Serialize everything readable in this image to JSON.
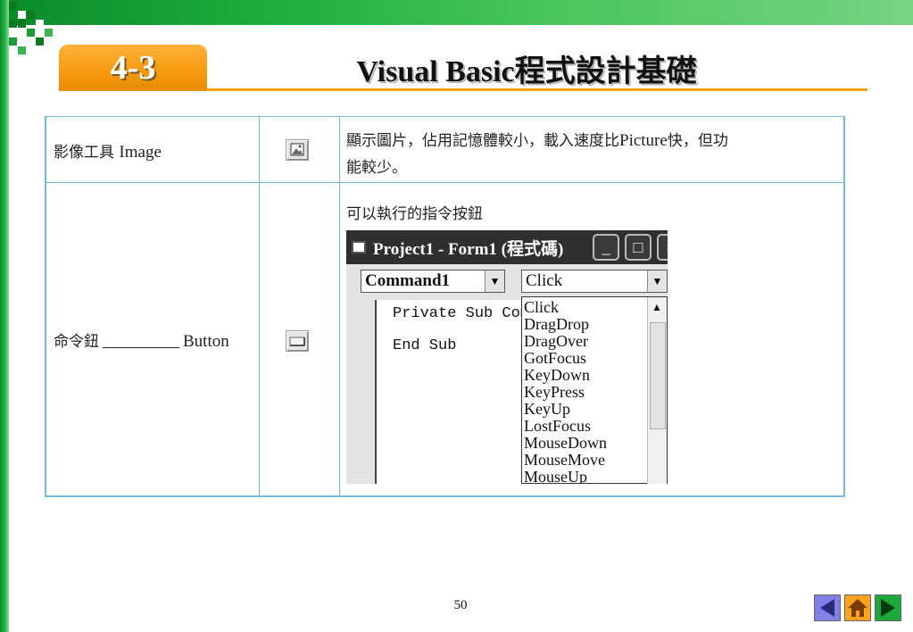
{
  "header": {
    "section_number": "4-3",
    "title": "Visual Basic程式設計基礎"
  },
  "table": {
    "rows": [
      {
        "name_text": "影像工具 ",
        "name_latin": "Image",
        "icon": "picture-icon",
        "desc_part1": "顯示圖片，佔用記憶體較小，載入速度比",
        "desc_latin": "Picture",
        "desc_part2": "快，但功",
        "desc_line2": "能較少。"
      },
      {
        "name_text": "命令鈕",
        "name_latin": "Button",
        "icon": "command-button-icon",
        "desc": "可以執行的指令按鈕"
      }
    ]
  },
  "vb_window": {
    "title": "Project1 - Form1 (程式碼)",
    "object_combo": "Command1",
    "event_combo": "Click",
    "code_line1": "Private Sub Comm",
    "code_line2": "End Sub",
    "events": [
      "Click",
      "DragDrop",
      "DragOver",
      "GotFocus",
      "KeyDown",
      "KeyPress",
      "KeyUp",
      "LostFocus",
      "MouseDown",
      "MouseMove",
      "MouseUp"
    ]
  },
  "footer": {
    "page_number": "50",
    "nav": [
      "back-icon",
      "home-icon",
      "forward-icon"
    ]
  },
  "colors": {
    "green_band": "#1fae3e",
    "orange_accent": "#f59a10",
    "table_border": "#74b9d6",
    "nav_back": "#7f7fe0",
    "nav_home": "#ff9f1a",
    "nav_forward": "#1aa33a"
  }
}
